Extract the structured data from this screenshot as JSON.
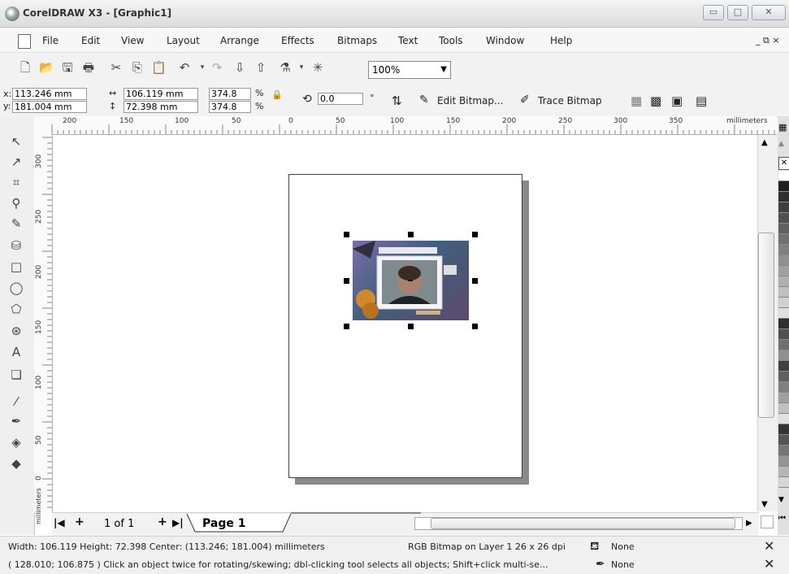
{
  "window": {
    "title": "CorelDRAW X3 - [Graphic1]",
    "controls": [
      "▭",
      "□",
      "✕"
    ]
  },
  "menubar": {
    "items": [
      "File",
      "Edit",
      "View",
      "Layout",
      "Arrange",
      "Effects",
      "Bitmaps",
      "Text",
      "Tools",
      "Window",
      "Help"
    ],
    "doc_controls": "_ ⧉ ×"
  },
  "toolbar": {
    "zoom_value": "100%"
  },
  "propbar": {
    "x_label": "x:",
    "y_label": "y:",
    "x_value": "113.246 mm",
    "y_value": "181.004 mm",
    "width_value": "106.119 mm",
    "height_value": "72.398 mm",
    "scale_x": "374.8",
    "scale_y": "374.8",
    "pct": "%",
    "rotation_value": "0.0",
    "degree": "°",
    "edit_bitmap_label": "Edit Bitmap...",
    "trace_bitmap_label": "Trace Bitmap"
  },
  "rulers": {
    "units_label": "millimeters",
    "h_ticks": [
      "200",
      "150",
      "100",
      "50",
      "0",
      "50",
      "100",
      "150",
      "200",
      "250",
      "300",
      "350"
    ],
    "v_ticks": [
      "300",
      "250",
      "200",
      "150",
      "100",
      "50",
      "0"
    ],
    "v_units": "millimeters"
  },
  "pagebar": {
    "page_count": "1 of 1",
    "page_tab": "Page 1"
  },
  "status": {
    "line1_left": "Width: 106.119  Height: 72.398  Center: (113.246; 181.004)  millimeters",
    "line1_mid": "RGB Bitmap on Layer 1 26 x 26 dpi",
    "line1_fill": "None",
    "line2_left": "( 128.010; 106.875 )   Click an object twice for rotating/skewing; dbl-clicking tool selects all objects; Shift+click multi-se...",
    "line2_outline": "None"
  },
  "colors": {
    "palette": [
      "#ffffff",
      "#202020",
      "#303030",
      "#404040",
      "#505050",
      "#606060",
      "#707070",
      "#808080",
      "#909090",
      "#a0a0a0",
      "#b0b0b0",
      "#c0c0c0",
      "#d0d0d0",
      "#e0e0e0",
      "#303030",
      "#505050",
      "#707070",
      "#909090",
      "#404040",
      "#606060",
      "#808080",
      "#a0a0a0",
      "#c0c0c0",
      "#e0e0e0",
      "#353535",
      "#555555",
      "#757575",
      "#959595",
      "#b5b5b5",
      "#d5d5d5"
    ]
  }
}
